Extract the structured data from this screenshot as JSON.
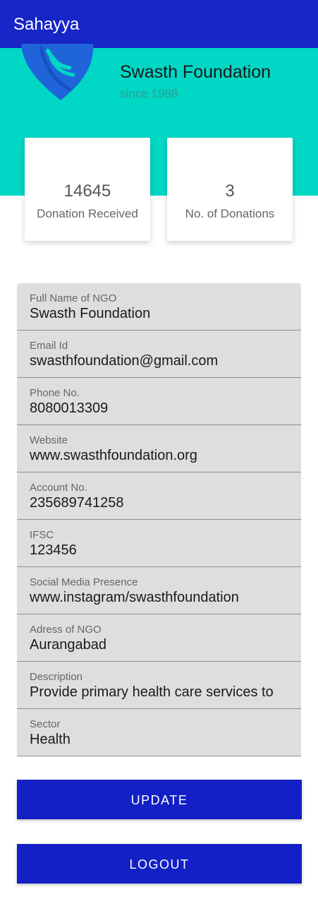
{
  "appbar": {
    "title": "Sahayya"
  },
  "colors": {
    "appbar": "#1726c6",
    "hero": "#00d7c5",
    "button": "#1320c5",
    "logo": "#1f64d8"
  },
  "profile": {
    "name": "Swasth Foundation",
    "since": "since 1988",
    "logo_icon": "heart-hands-icon"
  },
  "stats": [
    {
      "value": "14645",
      "label": "Donation Received"
    },
    {
      "value": "3",
      "label": "No. of Donations"
    }
  ],
  "fields": [
    {
      "label": "Full Name of NGO",
      "value": "Swasth Foundation"
    },
    {
      "label": "Email Id",
      "value": "swasthfoundation@gmail.com"
    },
    {
      "label": "Phone No.",
      "value": "8080013309"
    },
    {
      "label": "Website",
      "value": "www.swasthfoundation.org"
    },
    {
      "label": "Account No.",
      "value": "235689741258"
    },
    {
      "label": "IFSC",
      "value": "123456"
    },
    {
      "label": "Social Media Presence",
      "value": "www.instagram/swasthfoundation"
    },
    {
      "label": "Adress of NGO",
      "value": "Aurangabad"
    },
    {
      "label": "Description",
      "value": "Provide primary health care services to"
    },
    {
      "label": "Sector",
      "value": "Health"
    }
  ],
  "buttons": {
    "update": "UPDATE",
    "logout": "LOGOUT"
  }
}
